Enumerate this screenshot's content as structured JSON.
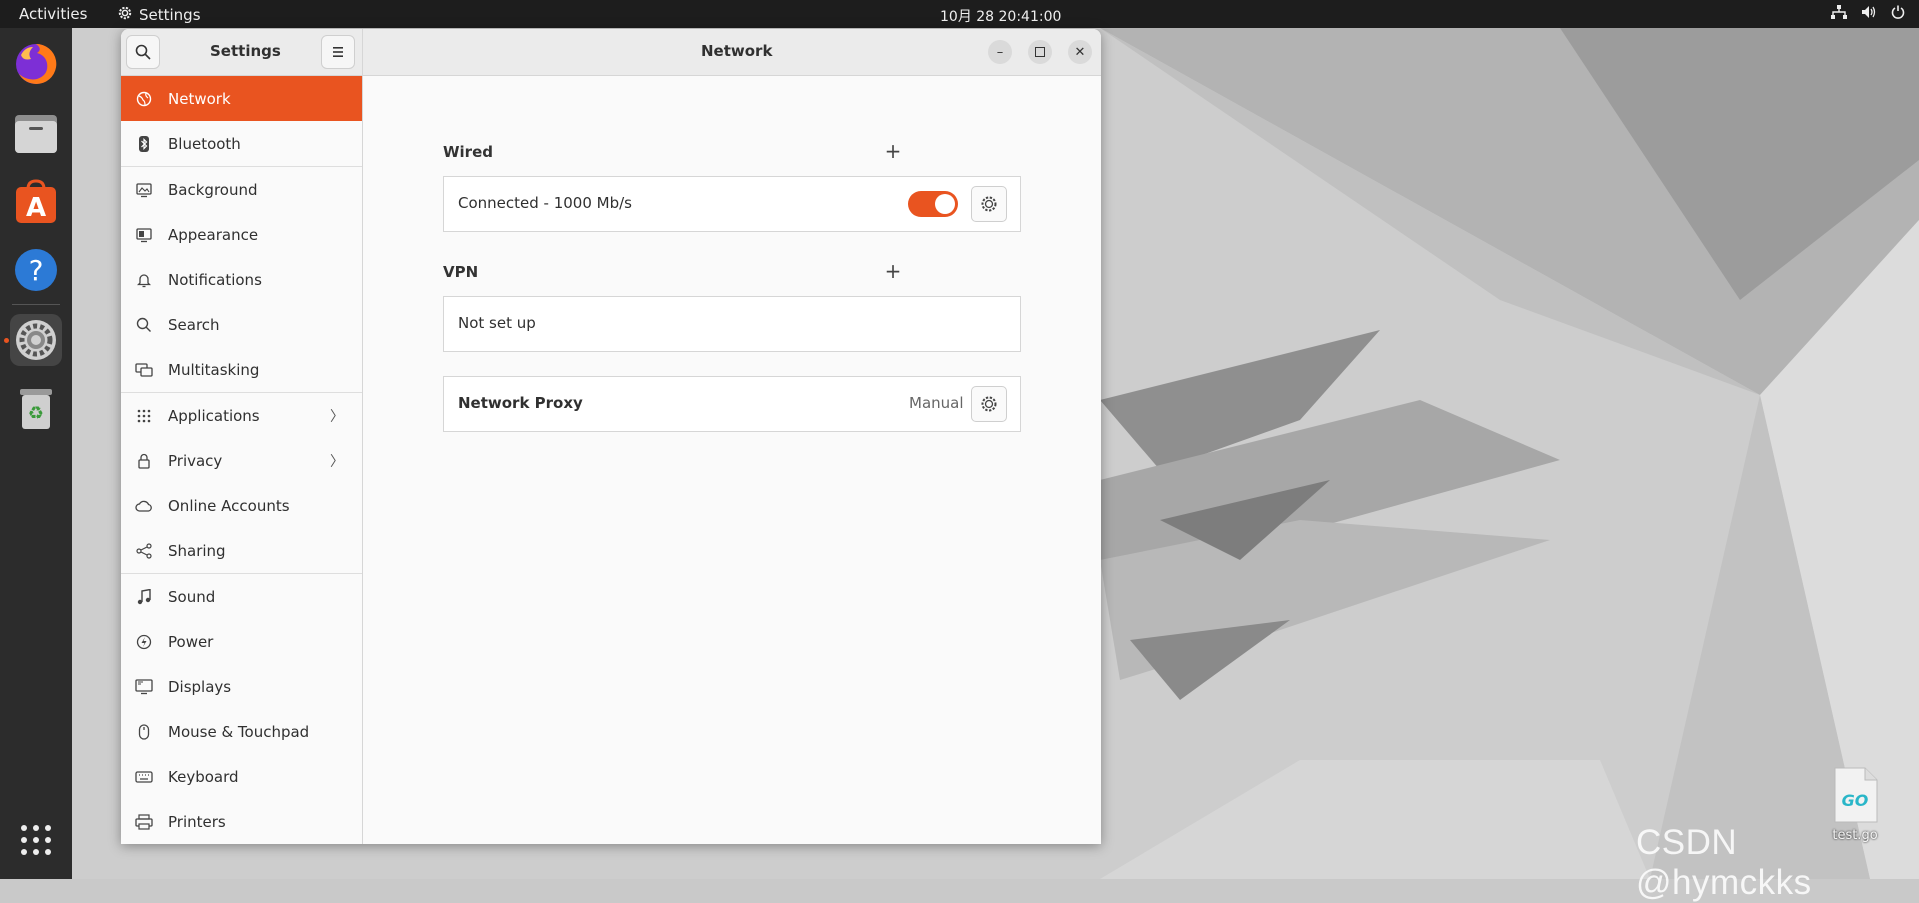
{
  "topbar": {
    "activities": "Activities",
    "app_name": "Settings",
    "clock": "10月 28  20:41:00"
  },
  "dock": {
    "items": [
      "firefox-icon",
      "files-icon",
      "software-icon",
      "help-icon",
      "settings-icon",
      "trash-icon",
      "show-apps-icon"
    ],
    "active_item": "settings-icon"
  },
  "window": {
    "sidebar_title": "Settings",
    "main_title": "Network"
  },
  "sidebar": {
    "items": [
      {
        "label": "Network",
        "icon": "network-icon"
      },
      {
        "label": "Bluetooth",
        "icon": "bluetooth-icon"
      },
      {
        "label": "Background",
        "icon": "background-icon"
      },
      {
        "label": "Appearance",
        "icon": "appearance-icon"
      },
      {
        "label": "Notifications",
        "icon": "bell-icon"
      },
      {
        "label": "Search",
        "icon": "search-icon"
      },
      {
        "label": "Multitasking",
        "icon": "multitasking-icon"
      },
      {
        "label": "Applications",
        "icon": "apps-grid-icon"
      },
      {
        "label": "Privacy",
        "icon": "lock-icon"
      },
      {
        "label": "Online Accounts",
        "icon": "cloud-icon"
      },
      {
        "label": "Sharing",
        "icon": "share-icon"
      },
      {
        "label": "Sound",
        "icon": "music-note-icon"
      },
      {
        "label": "Power",
        "icon": "power-icon"
      },
      {
        "label": "Displays",
        "icon": "display-icon"
      },
      {
        "label": "Mouse & Touchpad",
        "icon": "mouse-icon"
      },
      {
        "label": "Keyboard",
        "icon": "keyboard-icon"
      },
      {
        "label": "Printers",
        "icon": "printer-icon"
      }
    ],
    "selected": "Network"
  },
  "content": {
    "wired": {
      "title": "Wired",
      "status": "Connected - 1000 Mb/s",
      "enabled": true
    },
    "vpn": {
      "title": "VPN",
      "status": "Not set up"
    },
    "proxy": {
      "title": "Network Proxy",
      "value": "Manual"
    }
  },
  "desktop": {
    "file_label": "test.go",
    "watermark": "CSDN @hymckks"
  },
  "colors": {
    "accent": "#e95420",
    "topbar": "#1d1d1d",
    "dock": "#2c2c2c"
  }
}
